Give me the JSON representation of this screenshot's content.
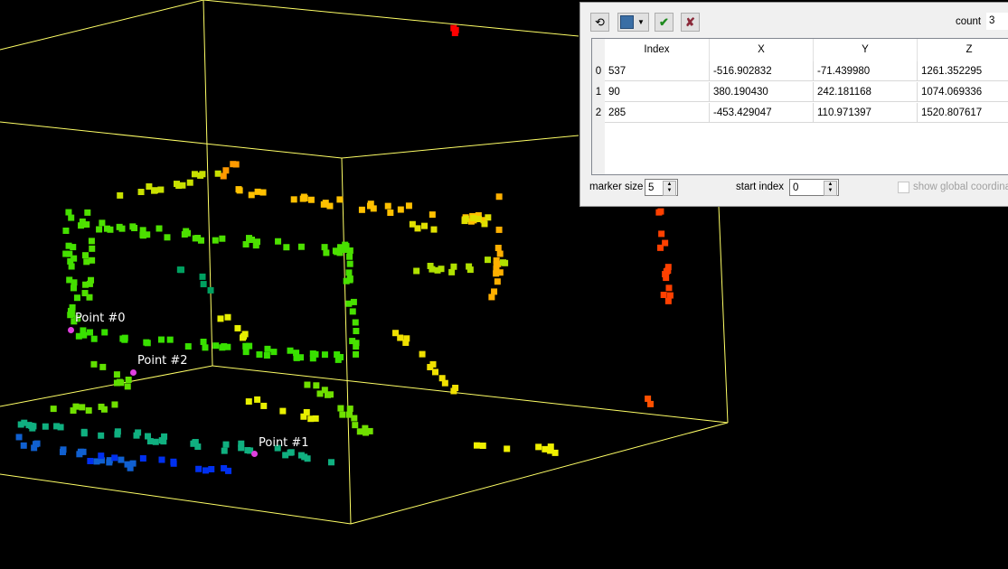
{
  "viewport": {
    "bbox_color": "#ffff66",
    "picked_points": [
      {
        "label": "Point #0"
      },
      {
        "label": "Point #1"
      },
      {
        "label": "Point #2"
      }
    ],
    "marker_color": "#e040e0"
  },
  "panel": {
    "toolbar": {
      "remove_last_icon": "undo-icon",
      "save_icon": "save-icon",
      "save_dropdown_icon": "chevron-down-icon",
      "validate_icon": "checkmark-icon",
      "cancel_icon": "close-icon"
    },
    "count_label": "count",
    "count_value": "3",
    "table": {
      "headers": [
        "Index",
        "X",
        "Y",
        "Z"
      ],
      "rows": [
        {
          "n": "0",
          "index": "537",
          "x": "-516.902832",
          "y": "-71.439980",
          "z": "1261.352295"
        },
        {
          "n": "1",
          "index": "90",
          "x": "380.190430",
          "y": "242.181168",
          "z": "1074.069336"
        },
        {
          "n": "2",
          "index": "285",
          "x": "-453.429047",
          "y": "110.971397",
          "z": "1520.807617"
        }
      ]
    },
    "marker_size_label": "marker size",
    "marker_size_value": "5",
    "start_index_label": "start index",
    "start_index_value": "0",
    "show_global_label": "show global coordinates",
    "show_global_checked": false
  }
}
